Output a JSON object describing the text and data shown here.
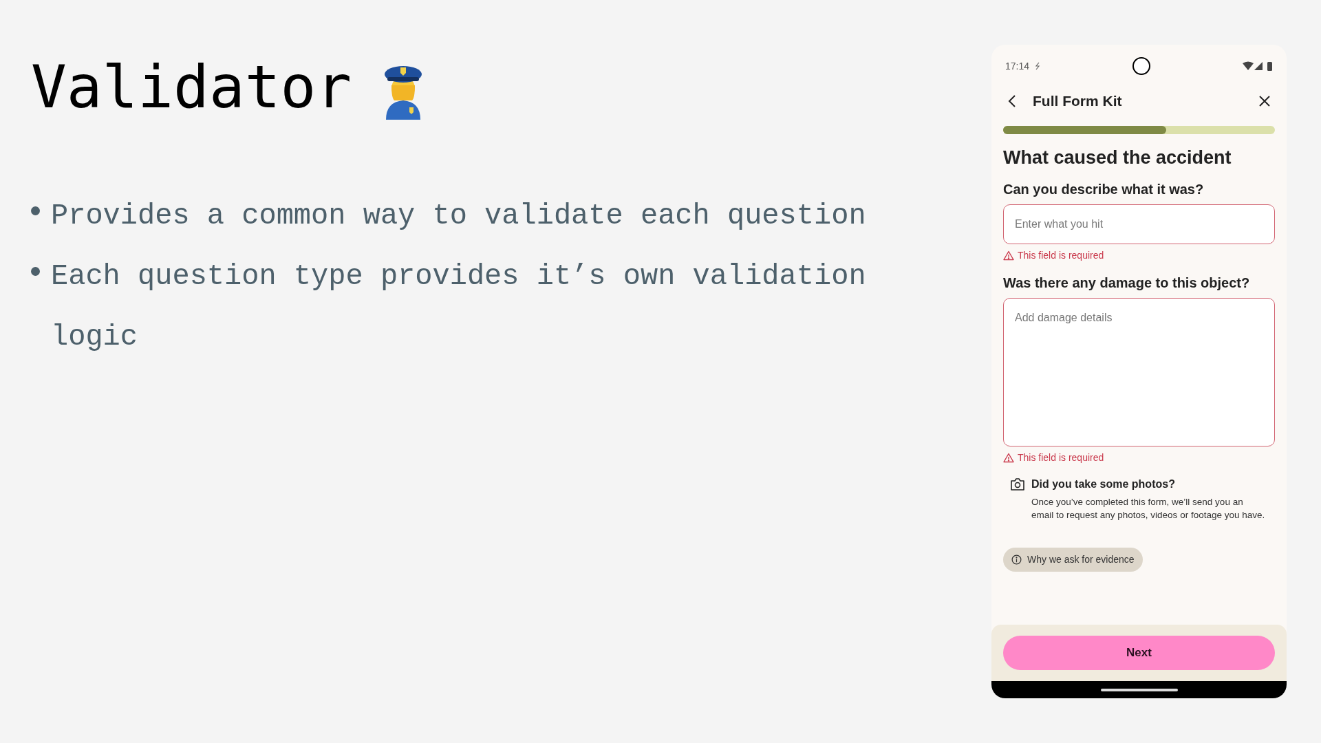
{
  "slide": {
    "title": "Validator",
    "bullets": [
      "Provides a common way to validate each question",
      "Each question type provides it’s own validation logic"
    ]
  },
  "phone": {
    "status_bar": {
      "time": "17:14"
    },
    "header": {
      "title": "Full Form Kit"
    },
    "progress": {
      "level": 0.6
    },
    "heading": "What caused the accident",
    "questions": [
      {
        "kind": "input",
        "label": "Can you describe what it was?",
        "placeholder": "Enter what you hit",
        "error": "This field is required"
      },
      {
        "kind": "textarea",
        "label": "Was there any damage to this object?",
        "placeholder": "Add damage details",
        "error": "This field is required"
      }
    ],
    "notice": {
      "title": "Did you take some photos?",
      "body": "Once you’ve completed this form, we’ll send you an email to request any photos, videos or footage you have."
    },
    "info_chip": "Why we ask for evidence",
    "next_button": "Next"
  }
}
